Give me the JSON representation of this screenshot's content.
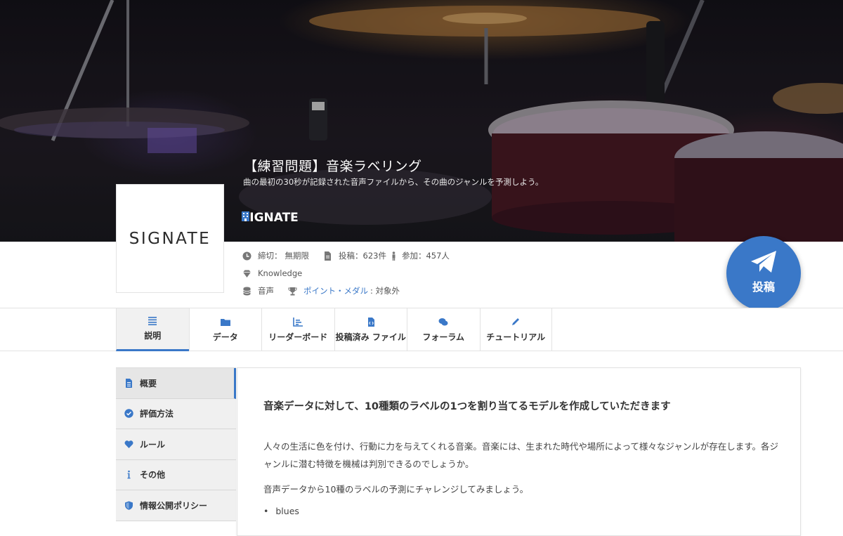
{
  "hero": {
    "title": "【練習問題】音楽ラベリング",
    "subtitle": "曲の最初の30秒が記録された音声ファイルから、その曲のジャンルを予測しよう。",
    "organizer": "SIGNATE"
  },
  "logo": {
    "text": "SIGNATE"
  },
  "meta": {
    "deadline_label": "締切：",
    "deadline_value": "無期限",
    "submissions_label": "投稿：",
    "submissions_value": "623件",
    "participants_label": "参加：",
    "participants_value": "457人",
    "level": "Knowledge",
    "category": "音声",
    "reward_link": "ポイント・メダル",
    "reward_value": ": 対象外"
  },
  "fab": {
    "label": "投稿"
  },
  "tabs": [
    {
      "label": "説明",
      "icon": "list-icon",
      "active": true
    },
    {
      "label": "データ",
      "icon": "folder-icon",
      "active": false
    },
    {
      "label": "リーダーボード",
      "icon": "bar-chart-icon",
      "active": false
    },
    {
      "label": "投稿済み ファイル",
      "icon": "code-file-icon",
      "active": false
    },
    {
      "label": "フォーラム",
      "icon": "comments-icon",
      "active": false
    },
    {
      "label": "チュートリアル",
      "icon": "pencil-icon",
      "active": false
    }
  ],
  "sidebar": {
    "items": [
      {
        "label": "概要",
        "icon": "file-text-icon",
        "active": true
      },
      {
        "label": "評価方法",
        "icon": "check-circle-icon",
        "active": false
      },
      {
        "label": "ルール",
        "icon": "heart-icon",
        "active": false
      },
      {
        "label": "その他",
        "icon": "info-icon",
        "active": false
      },
      {
        "label": "情報公開ポリシー",
        "icon": "shield-icon",
        "active": false
      }
    ]
  },
  "content": {
    "heading": "音楽データに対して、10種類のラベルの1つを割り当てるモデルを作成していただきます",
    "paragraph1": "人々の生活に色を付け、行動に力を与えてくれる音楽。音楽には、生まれた時代や場所によって様々なジャンルが存在します。各ジャンルに潜む特徴を機械は判別できるのでしょうか。",
    "paragraph2": "音声データから10種のラベルの予測にチャレンジしてみましょう。",
    "list": [
      "blues"
    ]
  },
  "colors": {
    "accent": "#3a78c8",
    "icon_gray": "#666666"
  }
}
